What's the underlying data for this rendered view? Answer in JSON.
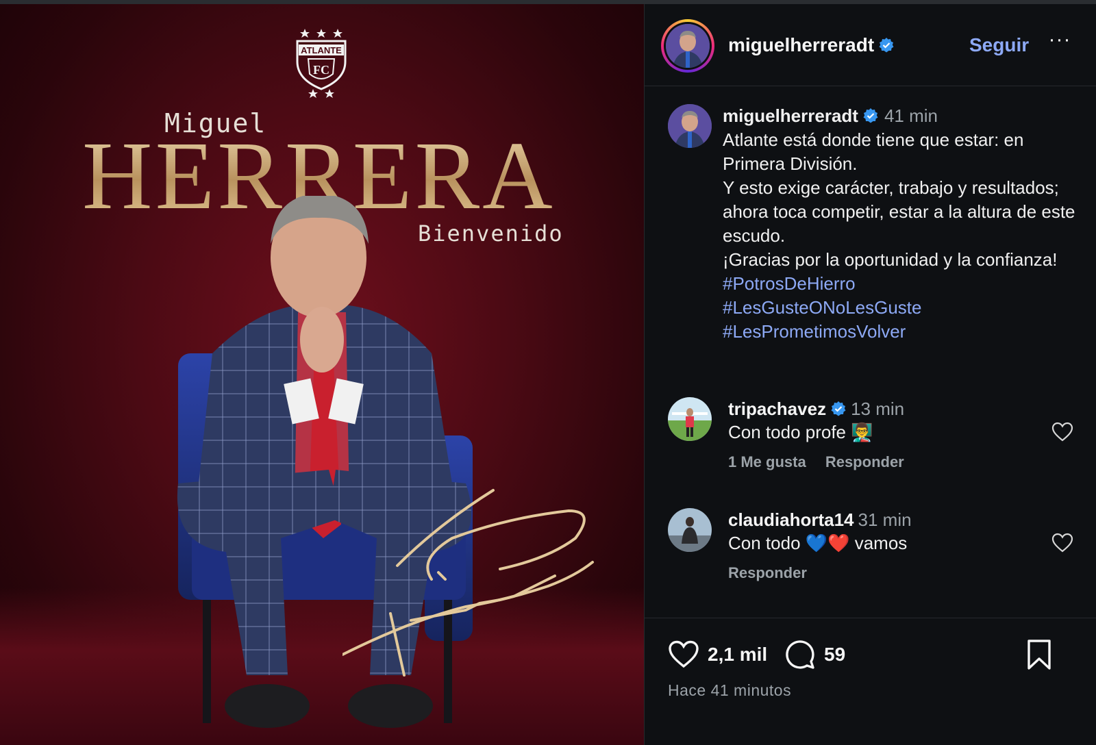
{
  "post": {
    "image": {
      "first_name": "Miguel",
      "last_name": "HERRERA",
      "subtitle": "Bienvenido",
      "crest_text": "ATLANTE",
      "crest_letters": "FC"
    },
    "header": {
      "username": "miguelherreradt",
      "follow_label": "Seguir",
      "more_label": "···"
    },
    "caption": {
      "username": "miguelherreradt",
      "time": "41 min",
      "lines": [
        "Atlante está donde tiene que estar: en Primera División.",
        "Y esto exige carácter, trabajo y resultados; ahora toca competir, estar a la altura de este escudo.",
        "¡Gracias por la oportunidad y la confianza!"
      ],
      "hashtags": [
        "#PotrosDeHierro",
        "#LesGusteONoLesGuste",
        "#LesPrometimosVolver"
      ]
    },
    "comments": [
      {
        "username": "tripachavez",
        "verified": true,
        "time": "13 min",
        "text": "Con todo profe 👨‍🏫",
        "likes_label": "1 Me gusta",
        "reply_label": "Responder"
      },
      {
        "username": "claudiahorta14",
        "verified": false,
        "time": "31 min",
        "text": "Con todo 💙❤️ vamos",
        "likes_label": "",
        "reply_label": "Responder"
      }
    ],
    "footer": {
      "likes_count": "2,1 mil",
      "comments_count": "59",
      "time_ago": "Hace 41 minutos"
    }
  },
  "colors": {
    "background": "#0e1013",
    "link": "#8da9f5",
    "muted": "#9ca3a9",
    "verified": "#3897f0",
    "gold": "#c9ab7c",
    "maroon": "#4c0a14"
  },
  "icons": [
    "heart-icon",
    "comment-icon",
    "bookmark-icon",
    "verified-badge-icon",
    "more-icon"
  ]
}
